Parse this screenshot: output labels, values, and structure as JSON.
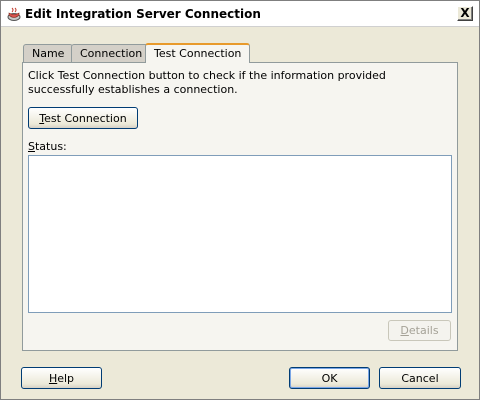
{
  "window": {
    "title": "Edit Integration Server Connection",
    "close_label": "X"
  },
  "tabs": [
    {
      "label": "Name",
      "active": false
    },
    {
      "label": "Connection",
      "active": false
    },
    {
      "label": "Test Connection",
      "active": true
    }
  ],
  "test_panel": {
    "description": "Click Test Connection button to check if the information provided successfully establishes a connection.",
    "test_button_mnemonic": "T",
    "test_button_rest": "est Connection",
    "status_mnemonic": "S",
    "status_label_rest": "tatus:",
    "status_text": "",
    "details_mnemonic": "D",
    "details_rest": "etails"
  },
  "footer": {
    "help_mnemonic": "H",
    "help_rest": "elp",
    "ok_label": "OK",
    "cancel_label": "Cancel"
  }
}
